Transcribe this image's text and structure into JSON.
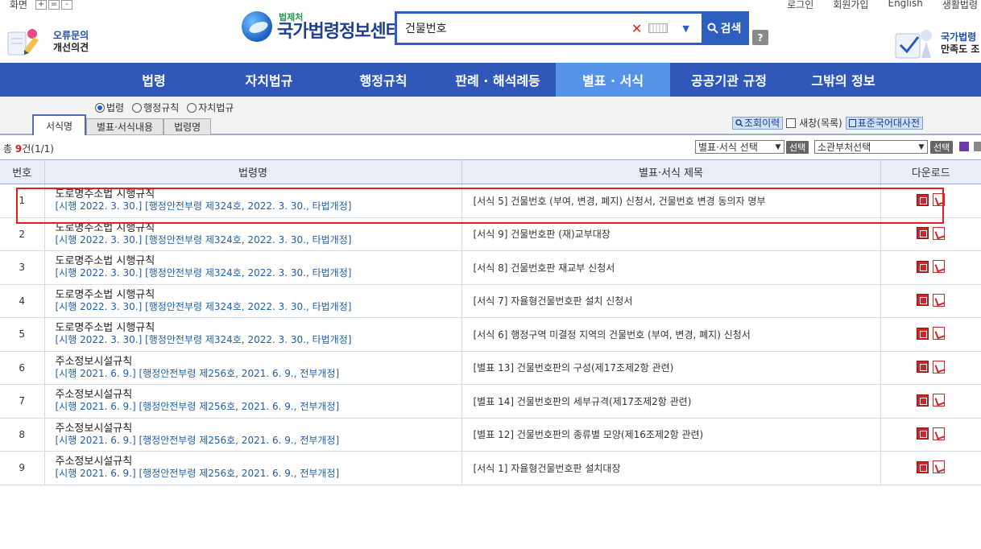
{
  "util": {
    "screen_label": "화면",
    "zoom_in": "+",
    "zoom_reset": "=",
    "zoom_out": "-",
    "links": [
      "로그인",
      "회원가입",
      "English",
      "생활법령"
    ]
  },
  "feedback": {
    "line1": "오류문의",
    "line2": "개선의견"
  },
  "logo": {
    "sub": "법제처",
    "main": "국가법령정보센터"
  },
  "search": {
    "value": "건물번호",
    "clear": "✕",
    "dropdown": "▼",
    "button": "검색",
    "help": "?"
  },
  "survey": {
    "line1": "국가법령",
    "line2": "만족도 조"
  },
  "nav": [
    {
      "label": "법령",
      "active": false
    },
    {
      "label": "자치법규",
      "active": false
    },
    {
      "label": "행정규칙",
      "active": false
    },
    {
      "label": "판례 · 해석례등",
      "active": false
    },
    {
      "label": "별표 · 서식",
      "active": true
    },
    {
      "label": "공공기관 규정",
      "active": false
    },
    {
      "label": "그밖의 정보",
      "active": false
    }
  ],
  "radios": [
    {
      "label": "법령",
      "checked": true
    },
    {
      "label": "행정규칙",
      "checked": false
    },
    {
      "label": "자치법규",
      "checked": false
    }
  ],
  "tabs": [
    {
      "label": "서식명",
      "active": true
    },
    {
      "label": "별표·서식내용",
      "active": false
    },
    {
      "label": "법령명",
      "active": false
    }
  ],
  "tools": {
    "history": "조회이력",
    "new_window": "새창(목록)",
    "dict": "표준국어대사전"
  },
  "results": {
    "prefix": "총 ",
    "count": "9",
    "suffix": "건(1/1)",
    "select1": "별표·서식 선택",
    "select2": "소관부처선택",
    "select_btn": "선택"
  },
  "table": {
    "headers": [
      "번호",
      "법령명",
      "별표·서식 제목",
      "다운로드"
    ],
    "rows": [
      {
        "num": "1",
        "law": "도로명주소법 시행규칙",
        "meta": "[시행 2022. 3. 30.] [행정안전부령 제324호, 2022. 3. 30., 타법개정]",
        "title": "[서식 5] 건물번호 (부여, 변경, 폐지) 신청서, 건물번호 변경 동의자 명부"
      },
      {
        "num": "2",
        "law": "도로명주소법 시행규칙",
        "meta": "[시행 2022. 3. 30.] [행정안전부령 제324호, 2022. 3. 30., 타법개정]",
        "title": "[서식 9] 건물번호판 (재)교부대장"
      },
      {
        "num": "3",
        "law": "도로명주소법 시행규칙",
        "meta": "[시행 2022. 3. 30.] [행정안전부령 제324호, 2022. 3. 30., 타법개정]",
        "title": "[서식 8] 건물번호판 재교부 신청서"
      },
      {
        "num": "4",
        "law": "도로명주소법 시행규칙",
        "meta": "[시행 2022. 3. 30.] [행정안전부령 제324호, 2022. 3. 30., 타법개정]",
        "title": "[서식 7] 자율형건물번호판 설치 신청서"
      },
      {
        "num": "5",
        "law": "도로명주소법 시행규칙",
        "meta": "[시행 2022. 3. 30.] [행정안전부령 제324호, 2022. 3. 30., 타법개정]",
        "title": "[서식 6] 행정구역 미결정 지역의 건물번호 (부여, 변경, 폐지) 신청서"
      },
      {
        "num": "6",
        "law": "주소정보시설규칙",
        "meta": "[시행 2021. 6. 9.] [행정안전부령 제256호, 2021. 6. 9., 전부개정]",
        "title": "[별표 13] 건물번호판의 구성(제17조제2항 관련)"
      },
      {
        "num": "7",
        "law": "주소정보시설규칙",
        "meta": "[시행 2021. 6. 9.] [행정안전부령 제256호, 2021. 6. 9., 전부개정]",
        "title": "[별표 14] 건물번호판의 세부규격(제17조제2항 관련)"
      },
      {
        "num": "8",
        "law": "주소정보시설규칙",
        "meta": "[시행 2021. 6. 9.] [행정안전부령 제256호, 2021. 6. 9., 전부개정]",
        "title": "[별표 12] 건물번호판의 종류별 모양(제16조제2항 관련)"
      },
      {
        "num": "9",
        "law": "주소정보시설규칙",
        "meta": "[시행 2021. 6. 9.] [행정안전부령 제256호, 2021. 6. 9., 전부개정]",
        "title": "[서식 1] 자율형건물번호판 설치대장"
      }
    ]
  }
}
